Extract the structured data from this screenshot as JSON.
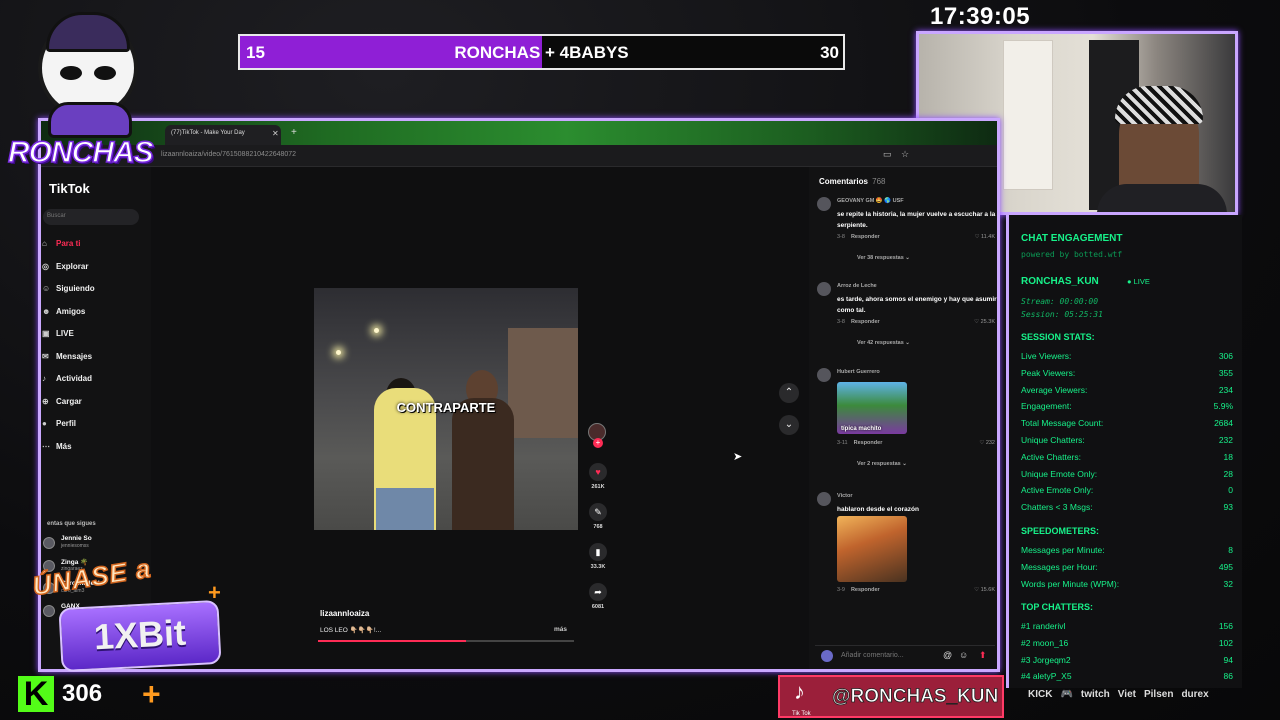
{
  "clock": "17:39:05",
  "score_bar": {
    "left_score": "15",
    "title_a": "RONCHAS",
    "title_b": "+ 4BABYS",
    "right_score": "30",
    "fill_fraction": 0.5,
    "fill_color": "#8f1fd6"
  },
  "logo_text": "RONCHAS",
  "browser": {
    "tab_title": "(77)TikTok - Make Your Day",
    "url": "lizaannloaiza/video/7615088210422648072"
  },
  "tiktok": {
    "logo": "TikTok",
    "search_placeholder": "Buscar",
    "nav": [
      {
        "label": "Para ti",
        "icon": "home-icon",
        "active": true
      },
      {
        "label": "Explorar",
        "icon": "compass-icon"
      },
      {
        "label": "Siguiendo",
        "icon": "users-icon"
      },
      {
        "label": "Amigos",
        "icon": "friends-icon"
      },
      {
        "label": "LIVE",
        "icon": "live-icon"
      },
      {
        "label": "Mensajes",
        "icon": "message-icon"
      },
      {
        "label": "Actividad",
        "icon": "bell-icon"
      },
      {
        "label": "Cargar",
        "icon": "upload-icon"
      },
      {
        "label": "Perfil",
        "icon": "profile-icon"
      },
      {
        "label": "Más",
        "icon": "more-icon"
      }
    ],
    "following_title": "entas que sigues",
    "following": [
      {
        "name": "Jennie So",
        "user": "jenniesomss"
      },
      {
        "name": "Zinga 🌴",
        "user": "zingaraez"
      },
      {
        "name": "Carolina.leal",
        "user": "caro_alm3"
      },
      {
        "name": "GANX",
        "user": "ganx_vt_"
      }
    ],
    "video_caption": "CONTRAPARTE",
    "video_author": "lizaannloaiza",
    "video_description": "LOS LEO 👇🏼👇🏼👇🏼!...",
    "video_more": "más",
    "progress_fraction": 0.58,
    "actions": [
      {
        "icon": "heart-icon",
        "count": "261K"
      },
      {
        "icon": "comment-icon",
        "count": "768"
      },
      {
        "icon": "bookmark-icon",
        "count": "33.3K"
      },
      {
        "icon": "share-icon",
        "count": "6081"
      }
    ],
    "comments_title": "Comentarios",
    "comments_count": "768",
    "comments": [
      {
        "user": "GEOVANY GM 🤩 🌎 USF",
        "text": "se repite la historia, la mujer vuelve a escuchar a la serpiente.",
        "date": "3-8",
        "reply": "Responder",
        "likes": "11.4K",
        "replies": "Ver 38 respuestas ⌄"
      },
      {
        "user": "Arroz de Leche",
        "text": "es tarde, ahora somos el enemigo y hay que asumir como tal.",
        "date": "3-8",
        "reply": "Responder",
        "likes": "25.3K",
        "replies": "Ver 42 respuestas ⌄"
      },
      {
        "user": "Hubert Guerrero",
        "text": "",
        "image_caption": "típica machito",
        "date": "3-11",
        "reply": "Responder",
        "likes": "232",
        "replies": "Ver 2 respuestas ⌄"
      },
      {
        "user": "Victor",
        "text": "hablaron desde el corazón",
        "date": "3-9",
        "reply": "Responder",
        "likes": "15.6K"
      }
    ],
    "comment_placeholder": "Añadir comentario..."
  },
  "engagement": {
    "title": "CHAT ENGAGEMENT",
    "powered": "powered by botted.wtf",
    "user": "RONCHAS_KUN",
    "live": "● LIVE",
    "stream": "Stream: 00:00:00",
    "session": "Session: 05:25:31",
    "stats_title": "SESSION STATS:",
    "stats": [
      {
        "label": "Live Viewers:",
        "value": "306"
      },
      {
        "label": "Peak Viewers:",
        "value": "355"
      },
      {
        "label": "Average Viewers:",
        "value": "234"
      },
      {
        "label": "Engagement:",
        "value": "5.9%"
      },
      {
        "label": "Total Message Count:",
        "value": "2684"
      },
      {
        "label": "Unique Chatters:",
        "value": "232"
      },
      {
        "label": "Active Chatters:",
        "value": "18"
      },
      {
        "label": "Unique Emote Only:",
        "value": "28"
      },
      {
        "label": "Active Emote Only:",
        "value": "0"
      },
      {
        "label": "Chatters < 3 Msgs:",
        "value": "93"
      }
    ],
    "speed_title": "SPEEDOMETERS:",
    "speed": [
      {
        "label": "Messages per Minute:",
        "value": "8"
      },
      {
        "label": "Messages per Hour:",
        "value": "495"
      },
      {
        "label": "Words per Minute (WPM):",
        "value": "32"
      }
    ],
    "top_title": "TOP CHATTERS:",
    "top": [
      {
        "label": "#1 randerivl",
        "value": "156"
      },
      {
        "label": "#2 moon_16",
        "value": "102"
      },
      {
        "label": "#3 Jorgeqm2",
        "value": "94"
      },
      {
        "label": "#4 aletyP_X5",
        "value": "86"
      }
    ]
  },
  "kick": {
    "badge": "K",
    "count": "306"
  },
  "promo": {
    "line1": "ÚNASE a",
    "line2": "1XBit"
  },
  "tiktok_handle": {
    "label": "Tik Tok",
    "handle": "@RONCHAS_KUN"
  },
  "sponsors": [
    "KICK",
    "🎮",
    "twitch",
    "Viet",
    "Pilsen",
    "durex"
  ]
}
